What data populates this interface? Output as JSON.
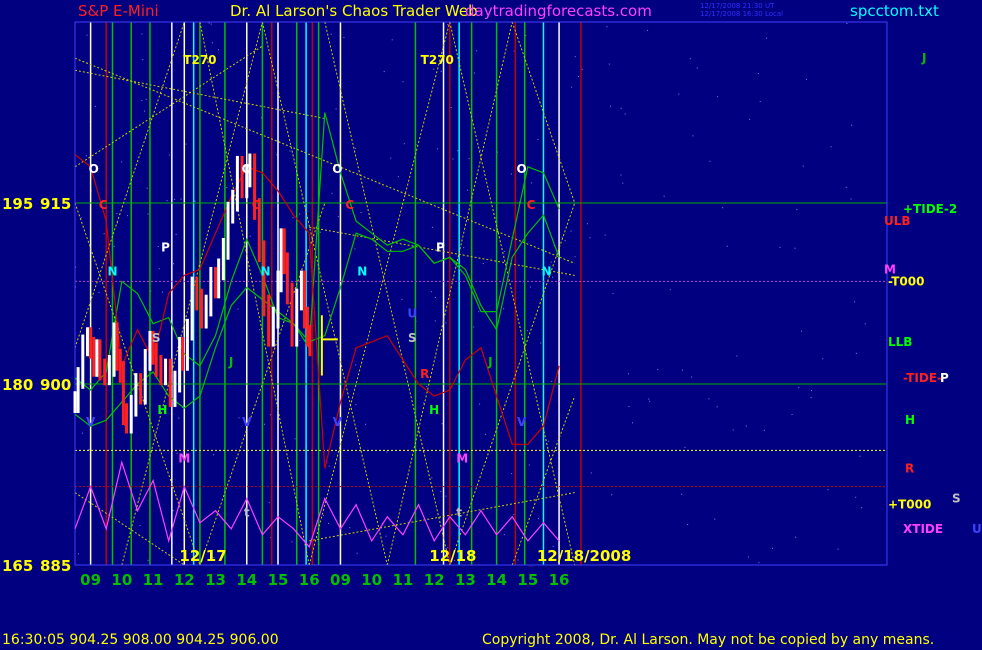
{
  "header": {
    "instrument": "S&P E-Mini",
    "title": "Dr. Al Larson's Chaos Trader Web",
    "site": "daytradingforecasts.com",
    "timestamps": [
      "12/17/2008 21:30 UT",
      "12/17/2008 16:30 Local"
    ],
    "file": "spcctom.txt"
  },
  "footer": {
    "quote": "16:30:05  904.25 908.00 904.25 906.00",
    "copyright": "Copyright 2008, Dr. Al Larson. May not be copied by any means."
  },
  "colors": {
    "background": "#000080",
    "price": "#ffffff",
    "price_down": "#ff2020",
    "green": "#00c000",
    "red": "#c00000",
    "yellow": "#ffff00",
    "magenta": "#ff40ff",
    "cyan": "#00ffff",
    "gold": "#c0a000"
  },
  "chart_data": {
    "type": "line",
    "title": "S&P E-Mini",
    "ylim": [
      885,
      930
    ],
    "y_ticks": [
      {
        "value": 915,
        "left": "195",
        "right": "915"
      },
      {
        "value": 900,
        "left": "180",
        "right": "900"
      },
      {
        "value": 885,
        "left": "165",
        "right": "885"
      }
    ],
    "x_range": [
      8.5,
      34.5
    ],
    "x_ticks": [
      {
        "x": 9,
        "label": "09"
      },
      {
        "x": 10,
        "label": "10"
      },
      {
        "x": 11,
        "label": "11"
      },
      {
        "x": 12,
        "label": "12"
      },
      {
        "x": 13,
        "label": "13"
      },
      {
        "x": 14,
        "label": "14"
      },
      {
        "x": 15,
        "label": "15"
      },
      {
        "x": 16,
        "label": "16"
      },
      {
        "x": 17,
        "label": "09"
      },
      {
        "x": 18,
        "label": "10"
      },
      {
        "x": 19,
        "label": "11"
      },
      {
        "x": 20,
        "label": "12"
      },
      {
        "x": 21,
        "label": "13"
      },
      {
        "x": 22,
        "label": "14"
      },
      {
        "x": 23,
        "label": "15"
      },
      {
        "x": 24,
        "label": "16"
      }
    ],
    "date_labels": [
      {
        "x": 12.6,
        "label": "12/17"
      },
      {
        "x": 20.6,
        "label": "12/18"
      },
      {
        "x": 24.8,
        "label": "12/18/2008"
      }
    ],
    "price": [
      [
        8.5,
        898.5
      ],
      [
        8.6,
        900.5
      ],
      [
        8.75,
        903.2
      ],
      [
        8.9,
        903.8
      ],
      [
        9.0,
        903.0
      ],
      [
        9.1,
        901.5
      ],
      [
        9.2,
        902.8
      ],
      [
        9.3,
        901.2
      ],
      [
        9.45,
        900.8
      ],
      [
        9.6,
        901.5
      ],
      [
        9.75,
        904.2
      ],
      [
        9.85,
        902.0
      ],
      [
        9.95,
        901.0
      ],
      [
        10.05,
        897.5
      ],
      [
        10.15,
        896.8
      ],
      [
        10.3,
        898.2
      ],
      [
        10.45,
        900.0
      ],
      [
        10.6,
        899.2
      ],
      [
        10.75,
        902.0
      ],
      [
        10.9,
        903.5
      ],
      [
        11.0,
        902.5
      ],
      [
        11.1,
        901.5
      ],
      [
        11.25,
        900.8
      ],
      [
        11.4,
        901.2
      ],
      [
        11.55,
        899.0
      ],
      [
        11.7,
        900.2
      ],
      [
        11.85,
        903.0
      ],
      [
        11.95,
        902.0
      ],
      [
        12.1,
        904.5
      ],
      [
        12.25,
        908.0
      ],
      [
        12.4,
        907.0
      ],
      [
        12.55,
        905.5
      ],
      [
        12.7,
        906.5
      ],
      [
        12.85,
        908.8
      ],
      [
        13.0,
        908.0
      ],
      [
        13.1,
        909.5
      ],
      [
        13.25,
        911.2
      ],
      [
        13.4,
        914.2
      ],
      [
        13.55,
        915.2
      ],
      [
        13.7,
        918.0
      ],
      [
        13.85,
        916.3
      ],
      [
        14.0,
        917.2
      ],
      [
        14.1,
        918.2
      ],
      [
        14.25,
        914.5
      ],
      [
        14.4,
        911.0
      ],
      [
        14.55,
        906.5
      ],
      [
        14.7,
        904.0
      ],
      [
        14.85,
        905.5
      ],
      [
        15.0,
        908.5
      ],
      [
        15.1,
        912.0
      ],
      [
        15.2,
        910.0
      ],
      [
        15.3,
        907.5
      ],
      [
        15.45,
        904.0
      ],
      [
        15.6,
        907.0
      ],
      [
        15.75,
        908.5
      ],
      [
        15.85,
        905.5
      ],
      [
        15.95,
        904.0
      ],
      [
        16.02,
        903.2
      ]
    ],
    "series": [
      {
        "name": "LLB",
        "values": [
          [
            8.5,
            900.5
          ],
          [
            9.0,
            899.5
          ],
          [
            9.5,
            901.0
          ],
          [
            10.0,
            908.5
          ],
          [
            10.5,
            907.5
          ],
          [
            11.0,
            905.0
          ],
          [
            11.5,
            905.5
          ],
          [
            12.0,
            902.5
          ],
          [
            12.5,
            901.5
          ],
          [
            13.0,
            904.0
          ],
          [
            13.5,
            908.5
          ],
          [
            14.0,
            912.0
          ],
          [
            14.5,
            909.0
          ],
          [
            15.0,
            905.5
          ],
          [
            15.5,
            905.0
          ],
          [
            16.0,
            903.5
          ],
          [
            16.5,
            904.0
          ],
          [
            17.0,
            908.0
          ],
          [
            17.5,
            912.5
          ],
          [
            18.0,
            912.0
          ],
          [
            18.5,
            911.0
          ],
          [
            19.0,
            911.0
          ],
          [
            19.5,
            911.5
          ],
          [
            20.0,
            910.0
          ],
          [
            20.5,
            910.5
          ],
          [
            21.0,
            909.5
          ],
          [
            21.5,
            906.5
          ],
          [
            22.0,
            904.5
          ],
          [
            22.5,
            910.5
          ],
          [
            23.0,
            912.5
          ],
          [
            23.5,
            914.0
          ],
          [
            24.0,
            910.5
          ]
        ]
      },
      {
        "name": "H",
        "values": [
          [
            8.5,
            897.5
          ],
          [
            9.0,
            896.5
          ],
          [
            9.5,
            897.0
          ],
          [
            10.0,
            898.5
          ],
          [
            10.5,
            900.0
          ],
          [
            11.0,
            901.0
          ],
          [
            11.5,
            899.0
          ],
          [
            12.0,
            898.0
          ],
          [
            12.5,
            899.0
          ],
          [
            13.0,
            903.0
          ],
          [
            13.5,
            906.5
          ],
          [
            14.0,
            908.0
          ],
          [
            14.5,
            907.0
          ],
          [
            15.0,
            906.0
          ],
          [
            15.5,
            905.0
          ],
          [
            16.0,
            903.0
          ],
          [
            16.5,
            922.5
          ],
          [
            17.0,
            917.5
          ],
          [
            17.5,
            913.5
          ],
          [
            18.0,
            912.5
          ],
          [
            18.5,
            911.5
          ],
          [
            19.0,
            912.0
          ],
          [
            19.5,
            911.5
          ],
          [
            20.0,
            910.0
          ],
          [
            20.5,
            910.5
          ],
          [
            21.0,
            909.0
          ],
          [
            21.5,
            906.0
          ],
          [
            22.0,
            906.0
          ],
          [
            22.5,
            912.0
          ],
          [
            23.0,
            918.0
          ],
          [
            23.5,
            917.5
          ],
          [
            24.0,
            914.5
          ]
        ]
      },
      {
        "name": "ULB",
        "values": [
          [
            8.5,
            919.0
          ],
          [
            9.0,
            918.0
          ],
          [
            9.5,
            913.5
          ],
          [
            10.0,
            901.5
          ],
          [
            10.5,
            904.5
          ],
          [
            11.0,
            902.0
          ],
          [
            11.5,
            907.5
          ],
          [
            12.0,
            909.0
          ],
          [
            12.5,
            909.5
          ],
          [
            13.0,
            912.5
          ],
          [
            13.5,
            915.5
          ],
          [
            14.0,
            918.0
          ],
          [
            14.5,
            917.5
          ],
          [
            15.0,
            916.0
          ],
          [
            15.5,
            914.0
          ],
          [
            16.0,
            912.5
          ],
          [
            16.5,
            893.0
          ],
          [
            17.0,
            898.5
          ],
          [
            17.5,
            903.0
          ],
          [
            18.0,
            903.5
          ],
          [
            18.5,
            904.0
          ],
          [
            19.0,
            902.0
          ],
          [
            19.5,
            900.0
          ],
          [
            20.0,
            899.0
          ],
          [
            20.5,
            899.5
          ],
          [
            21.0,
            902.0
          ],
          [
            21.5,
            903.0
          ],
          [
            22.0,
            899.0
          ],
          [
            22.5,
            895.0
          ],
          [
            23.0,
            895.0
          ],
          [
            23.5,
            896.5
          ],
          [
            24.0,
            901.5
          ]
        ]
      },
      {
        "name": "XTIDE",
        "values": [
          [
            8.5,
            888.0
          ],
          [
            9.0,
            891.5
          ],
          [
            9.5,
            888.0
          ],
          [
            10.0,
            893.5
          ],
          [
            10.5,
            889.5
          ],
          [
            11.0,
            892.0
          ],
          [
            11.5,
            887.0
          ],
          [
            12.0,
            891.5
          ],
          [
            12.5,
            888.5
          ],
          [
            13.0,
            889.5
          ],
          [
            13.5,
            888.0
          ],
          [
            14.0,
            890.5
          ],
          [
            14.5,
            887.5
          ],
          [
            15.0,
            889.0
          ],
          [
            15.5,
            888.0
          ],
          [
            16.0,
            886.5
          ],
          [
            16.5,
            890.5
          ],
          [
            17.0,
            888.0
          ],
          [
            17.5,
            890.0
          ],
          [
            18.0,
            887.0
          ],
          [
            18.5,
            889.0
          ],
          [
            19.0,
            887.5
          ],
          [
            19.5,
            890.0
          ],
          [
            20.0,
            887.0
          ],
          [
            20.5,
            889.0
          ],
          [
            21.0,
            887.5
          ],
          [
            21.5,
            889.5
          ],
          [
            22.0,
            887.5
          ],
          [
            22.5,
            889.0
          ],
          [
            23.0,
            887.0
          ],
          [
            23.5,
            888.5
          ],
          [
            24.0,
            887.0
          ]
        ]
      }
    ],
    "vertical_lines": {
      "white": [
        9.0,
        11.6,
        12.0,
        14.0,
        15.0,
        17.0,
        20.3,
        24.0
      ],
      "green": [
        9.7,
        10.3,
        10.9,
        12.5,
        13.3,
        14.5,
        15.6,
        16.3,
        19.4,
        21.2,
        22.0,
        22.9
      ],
      "red": [
        9.5,
        14.8,
        16.1,
        20.5,
        22.6,
        24.7
      ],
      "cyan": [
        12.3,
        15.9,
        20.8,
        23.5
      ]
    },
    "horizontal_lines": [
      {
        "value": 915,
        "color": "#00b000"
      },
      {
        "value": 900,
        "color": "#00b000"
      },
      {
        "value": 885,
        "color": "#00b000"
      },
      {
        "value": 908.5,
        "color": "#c040c0"
      },
      {
        "value": 894.5,
        "color": "#ffff00"
      },
      {
        "value": 891.5,
        "color": "#c00000"
      }
    ],
    "point_labels": [
      {
        "x": 9.1,
        "y": 917.5,
        "text": "O",
        "color": "#ffffff"
      },
      {
        "x": 9.4,
        "y": 914.5,
        "text": "C",
        "color": "#ff2020"
      },
      {
        "x": 9.7,
        "y": 909.0,
        "text": "N",
        "color": "#00ffff"
      },
      {
        "x": 9.0,
        "y": 896.5,
        "text": "V",
        "color": "#4040ff"
      },
      {
        "x": 11.4,
        "y": 911.0,
        "text": "P",
        "color": "#ffffff"
      },
      {
        "x": 11.1,
        "y": 903.5,
        "text": "S",
        "color": "#c0c0c0"
      },
      {
        "x": 11.3,
        "y": 897.5,
        "text": "H",
        "color": "#00ff00"
      },
      {
        "x": 12.0,
        "y": 893.5,
        "text": "M",
        "color": "#ff40ff"
      },
      {
        "x": 13.5,
        "y": 901.5,
        "text": "J",
        "color": "#00c000"
      },
      {
        "x": 14.0,
        "y": 917.5,
        "text": "O",
        "color": "#ffffff"
      },
      {
        "x": 14.3,
        "y": 914.5,
        "text": "C",
        "color": "#ff2020"
      },
      {
        "x": 14.6,
        "y": 909.0,
        "text": "N",
        "color": "#00ffff"
      },
      {
        "x": 14.0,
        "y": 896.5,
        "text": "V",
        "color": "#4040ff"
      },
      {
        "x": 14.0,
        "y": 889.0,
        "text": "t",
        "color": "#c0c0c0"
      },
      {
        "x": 16.9,
        "y": 917.5,
        "text": "O",
        "color": "#ffffff"
      },
      {
        "x": 17.3,
        "y": 914.5,
        "text": "C",
        "color": "#ff2020"
      },
      {
        "x": 17.7,
        "y": 909.0,
        "text": "N",
        "color": "#00ffff"
      },
      {
        "x": 16.9,
        "y": 896.5,
        "text": "V",
        "color": "#4040ff"
      },
      {
        "x": 20.2,
        "y": 911.0,
        "text": "P",
        "color": "#ffffff"
      },
      {
        "x": 19.3,
        "y": 903.5,
        "text": "S",
        "color": "#c0c0c0"
      },
      {
        "x": 19.3,
        "y": 905.5,
        "text": "U",
        "color": "#4040ff"
      },
      {
        "x": 19.7,
        "y": 900.5,
        "text": "R",
        "color": "#ff2020"
      },
      {
        "x": 20.0,
        "y": 897.5,
        "text": "H",
        "color": "#00ff00"
      },
      {
        "x": 20.9,
        "y": 893.5,
        "text": "M",
        "color": "#ff40ff"
      },
      {
        "x": 20.8,
        "y": 889.0,
        "text": "t",
        "color": "#c0c0c0"
      },
      {
        "x": 22.8,
        "y": 917.5,
        "text": "O",
        "color": "#ffffff"
      },
      {
        "x": 23.1,
        "y": 914.5,
        "text": "C",
        "color": "#ff2020"
      },
      {
        "x": 23.6,
        "y": 909.0,
        "text": "N",
        "color": "#00ffff"
      },
      {
        "x": 22.8,
        "y": 896.5,
        "text": "V",
        "color": "#4040ff"
      },
      {
        "x": 21.8,
        "y": 901.5,
        "text": "J",
        "color": "#00c000"
      },
      {
        "x": 12.5,
        "y": 926.5,
        "text": "T270",
        "color": "#ffff00"
      },
      {
        "x": 20.1,
        "y": 926.5,
        "text": "T270",
        "color": "#ffff00"
      }
    ],
    "right_labels": [
      {
        "y": 927.0,
        "text": "J",
        "color": "#00c000"
      },
      {
        "y": 914.5,
        "text": "+TIDE-2",
        "color": "#00ff00"
      },
      {
        "y": 913.5,
        "text": "ULB",
        "color": "#ff2020"
      },
      {
        "y": 909.5,
        "text": "M",
        "color": "#ff40ff"
      },
      {
        "y": 908.5,
        "text": "-T000",
        "color": "#ffff00"
      },
      {
        "y": 903.5,
        "text": "LLB",
        "color": "#00ff00"
      },
      {
        "y": 900.5,
        "text": "-TIDE-",
        "color": "#ff2020"
      },
      {
        "y": 900.5,
        "text": "P",
        "color": "#ffffff"
      },
      {
        "y": 897.0,
        "text": "H",
        "color": "#00ff00"
      },
      {
        "y": 893.0,
        "text": "R",
        "color": "#ff2020"
      },
      {
        "y": 890.5,
        "text": "S",
        "color": "#c0c0c0"
      },
      {
        "y": 890.0,
        "text": "+T000",
        "color": "#ffff00"
      },
      {
        "y": 888.0,
        "text": "XTIDE",
        "color": "#ff40ff"
      },
      {
        "y": 888.0,
        "text": "U",
        "color": "#4040ff"
      }
    ]
  }
}
